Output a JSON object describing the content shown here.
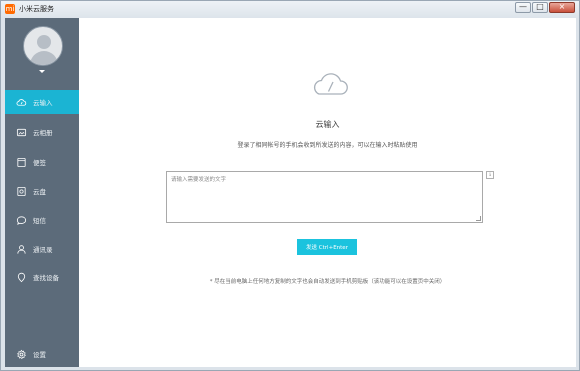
{
  "window": {
    "title": "小米云服务",
    "logo": "mi",
    "controls": {
      "minimize": "—",
      "maximize": "□",
      "close": "×"
    }
  },
  "sidebar": {
    "items": [
      {
        "label": "云输入",
        "icon": "cloud-input-icon",
        "active": true
      },
      {
        "label": "云相册",
        "icon": "photo-icon",
        "active": false
      },
      {
        "label": "便签",
        "icon": "note-icon",
        "active": false
      },
      {
        "label": "云盘",
        "icon": "disk-icon",
        "active": false
      },
      {
        "label": "短信",
        "icon": "message-icon",
        "active": false
      },
      {
        "label": "通讯录",
        "icon": "contacts-icon",
        "active": false
      },
      {
        "label": "查找设备",
        "icon": "find-device-icon",
        "active": false
      }
    ],
    "settings_label": "设置"
  },
  "main": {
    "title": "云输入",
    "description": "登录了相同帐号的手机会收到所发送的内容，可以在输入时粘贴使用",
    "input_placeholder": "请输入需要发送的文字",
    "info_label": "i",
    "send_label": "发送 Ctrl+Enter",
    "hint": "* 尽在当前电脑上任何地方复制的文字也会自动发送到手机剪贴板（该功能可以在设置页中关闭）"
  },
  "colors": {
    "accent": "#1bb4d3",
    "sidebar_bg": "#5c6b7a",
    "button": "#1bc3de"
  }
}
